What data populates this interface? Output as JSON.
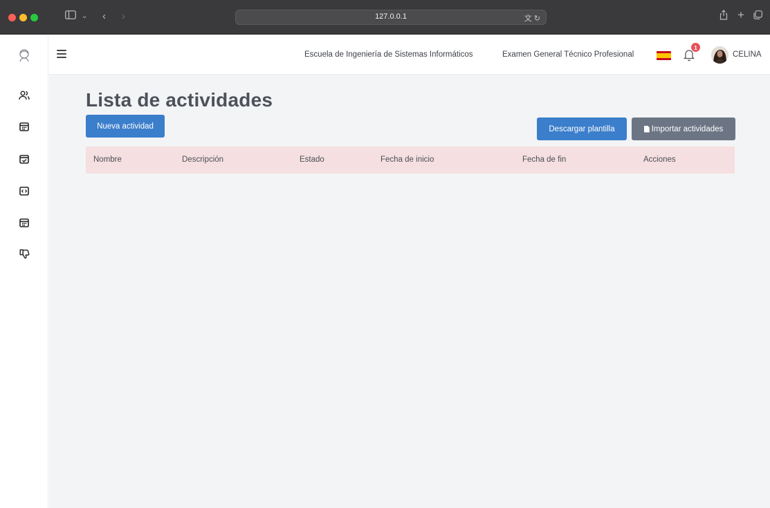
{
  "browser": {
    "url": "127.0.0.1"
  },
  "header": {
    "school_link": "Escuela de Ingeniería de Sistemas Informáticos",
    "exam_link": "Examen General Técnico Profesional",
    "language_flag": "spain-flag-icon",
    "notification_count": "1",
    "user_name": "CELINA"
  },
  "rail": {
    "items": [
      "users-icon",
      "calendar-icon",
      "calendar-check-icon",
      "code-box-icon",
      "calendar-icon",
      "thumbs-down-icon"
    ]
  },
  "main": {
    "title": "Lista de actividades",
    "new_button": "Nueva actividad",
    "download_button": "Descargar plantilla",
    "import_button": "Importar actividades",
    "table": {
      "columns": [
        "Nombre",
        "Descripción",
        "Estado",
        "Fecha de inicio",
        "Fecha de fin",
        "Acciones"
      ],
      "rows": []
    }
  },
  "colors": {
    "primary": "#3b7ecb",
    "secondary": "#6c7584",
    "table_header": "#f5dfe0",
    "badge": "#e7515a"
  }
}
